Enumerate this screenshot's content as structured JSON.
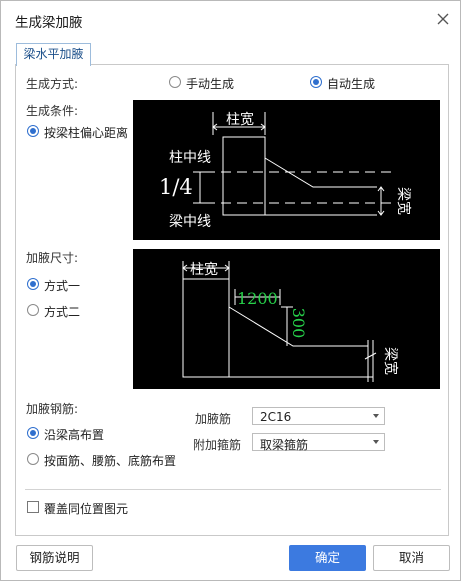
{
  "dialog": {
    "title": "生成梁加腋",
    "tab": "梁水平加腋"
  },
  "generation_mode": {
    "label": "生成方式:",
    "options": [
      "手动生成",
      "自动生成"
    ],
    "selected": "自动生成"
  },
  "generation_condition": {
    "label": "生成条件:",
    "option": "按梁柱偏心距离",
    "diagram": {
      "col_width": "柱宽",
      "col_center": "柱中线",
      "ratio": "1/4",
      "beam_center": "梁中线",
      "beam_width": "梁宽"
    }
  },
  "haunch_size": {
    "label": "加腋尺寸:",
    "options": [
      "方式一",
      "方式二"
    ],
    "selected": "方式一",
    "diagram": {
      "col_width": "柱宽",
      "length": "1200",
      "height": "300",
      "beam_width": "梁宽"
    }
  },
  "haunch_rebar": {
    "label": "加腋钢筋:",
    "options": [
      "沿梁高布置",
      "按面筋、腰筋、底筋布置"
    ],
    "selected": "沿梁高布置",
    "bar_label": "加腋筋",
    "bar_value": "2C16",
    "stirrup_label": "附加箍筋",
    "stirrup_value": "取梁箍筋"
  },
  "overwrite": {
    "label": "覆盖同位置图元",
    "checked": false
  },
  "buttons": {
    "help": "钢筋说明",
    "ok": "确定",
    "cancel": "取消"
  }
}
